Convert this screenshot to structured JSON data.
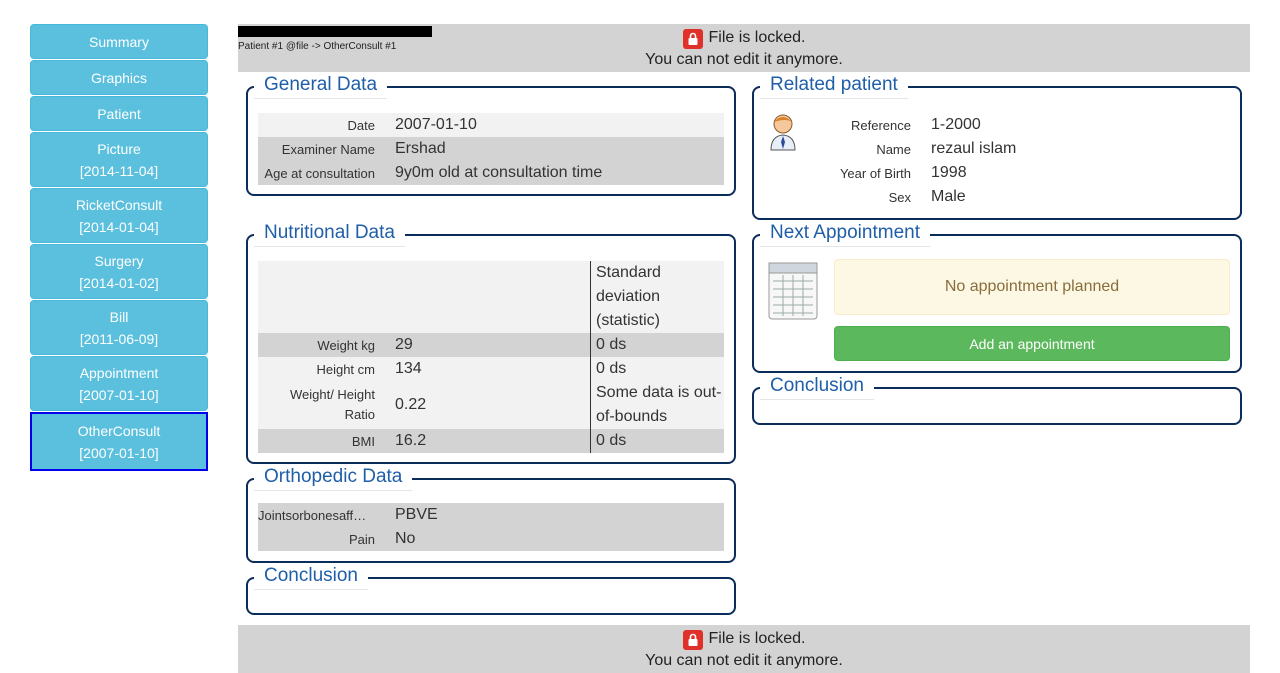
{
  "sidebar": {
    "items": [
      {
        "label": "Summary",
        "date": ""
      },
      {
        "label": "Graphics",
        "date": ""
      },
      {
        "label": "Patient",
        "date": ""
      },
      {
        "label": "Picture",
        "date": "[2014-11-04]"
      },
      {
        "label": "RicketConsult",
        "date": "[2014-01-04]"
      },
      {
        "label": "Surgery",
        "date": "[2014-01-02]"
      },
      {
        "label": "Bill",
        "date": "[2011-06-09]"
      },
      {
        "label": "Appointment",
        "date": "[2007-01-10]"
      },
      {
        "label": "OtherConsult",
        "date": "[2007-01-10]"
      }
    ]
  },
  "breadcrumb": "Patient #1 @file -> OtherConsult #1",
  "lock": {
    "line1": "File is locked.",
    "line2": "You can not edit it anymore."
  },
  "general": {
    "title": "General Data",
    "rows": [
      {
        "label": "Date",
        "value": "2007-01-10"
      },
      {
        "label": "Examiner Name",
        "value": "Ershad"
      },
      {
        "label": "Age at consultation",
        "value": "9y0m old at consultation time"
      }
    ]
  },
  "nutritional": {
    "title": "Nutritional Data",
    "header_col": "Standard deviation (statistic)",
    "rows": [
      {
        "label": "Weight kg",
        "value": "29",
        "sd": "0 ds"
      },
      {
        "label": "Height cm",
        "value": "134",
        "sd": "0 ds"
      },
      {
        "label": "Weight/ Height Ratio",
        "value": "0.22",
        "sd": "Some data is out-of-bounds"
      },
      {
        "label": "BMI",
        "value": "16.2",
        "sd": "0 ds"
      }
    ]
  },
  "orthopedic": {
    "title": "Orthopedic Data",
    "rows": [
      {
        "label": "Jointsorbonesaff…",
        "value": "PBVE"
      },
      {
        "label": "Pain",
        "value": "No"
      }
    ]
  },
  "conclusion_left": {
    "title": "Conclusion"
  },
  "related": {
    "title": "Related patient",
    "rows": [
      {
        "label": "Reference",
        "value": "1-2000"
      },
      {
        "label": "Name",
        "value": "rezaul islam"
      },
      {
        "label": "Year of Birth",
        "value": "1998"
      },
      {
        "label": "Sex",
        "value": "Male"
      }
    ]
  },
  "appointment": {
    "title": "Next Appointment",
    "none": "No appointment planned",
    "add_button": "Add an appointment"
  },
  "conclusion_right": {
    "title": "Conclusion"
  },
  "colors": {
    "sidebar_btn": "#5bc0de",
    "lock_bg": "#d3d3d3",
    "legend": "#1f5ea8",
    "border": "#0b2d5c",
    "success": "#5cb85c",
    "warning_bg": "#fcf8e3"
  },
  "icons": {
    "lock": "lock-icon",
    "patient": "patient-avatar-icon",
    "calendar": "calendar-icon"
  }
}
